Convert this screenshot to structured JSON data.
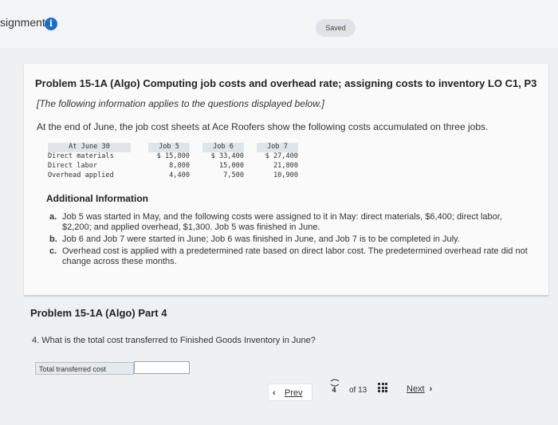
{
  "header": {
    "assignment_title": "signment",
    "info_icon_glyph": "i",
    "saved_label": "Saved"
  },
  "problem": {
    "title": "Problem 15-1A (Algo) Computing job costs and overhead rate; assigning costs to inventory LO C1, P3",
    "note": "[The following information applies to the questions displayed below.]",
    "intro": "At the end of June, the job cost sheets at Ace Roofers show the following costs accumulated on three jobs.",
    "table": {
      "header_label": "At June 30",
      "columns": [
        "Job 5",
        "Job 6",
        "Job 7"
      ],
      "rows": [
        {
          "label": "Direct materials",
          "values": [
            "$ 15,800",
            "$ 33,400",
            "$ 27,400"
          ]
        },
        {
          "label": "Direct labor",
          "values": [
            "8,800",
            "15,000",
            "21,800"
          ]
        },
        {
          "label": "Overhead applied",
          "values": [
            "4,400",
            "7,500",
            "10,900"
          ]
        }
      ]
    },
    "additional_title": "Additional Information",
    "additional_items": [
      {
        "letter": "a.",
        "text": "Job 5 was started in May, and the following costs were assigned to it in May: direct materials, $6,400; direct labor, $2,200; and applied overhead, $1,300. Job 5 was finished in June."
      },
      {
        "letter": "b.",
        "text": "Job 6 and Job 7 were started in June; Job 6 was finished in June, and Job 7 is to be completed in July."
      },
      {
        "letter": "c.",
        "text": "Overhead cost is applied with a predetermined rate based on direct labor cost. The predetermined overhead rate did not change across these months."
      }
    ]
  },
  "part": {
    "title": "Problem 15-1A (Algo) Part 4",
    "question": "4. What is the total cost transferred to Finished Goods Inventory in June?",
    "answer_label": "Total transferred cost",
    "answer_value": ""
  },
  "nav": {
    "prev_label": "Prev",
    "current_page": "4",
    "total_text": "of 13",
    "next_label": "Next",
    "page_icon": "bookmark-icon",
    "grid_icon": "grid-icon"
  }
}
